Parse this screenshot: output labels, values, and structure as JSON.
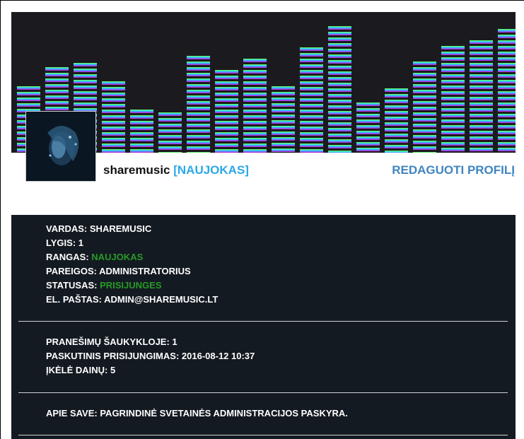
{
  "profile": {
    "username": "sharemusic",
    "rank_badge": "[NAUJOKAS]",
    "edit_label": "REDAGUOTI PROFILĮ"
  },
  "details": {
    "name_label": "VARDAS:",
    "name_value": "SHAREMUSIC",
    "level_label": "LYGIS:",
    "level_value": "1",
    "rank_label": "RANGAS:",
    "rank_value": "NAUJOKAS",
    "duties_label": "PAREIGOS:",
    "duties_value": "ADMINISTRATORIUS",
    "status_label": "STATUSAS:",
    "status_value": "PRISIJUNGES",
    "email_label": "EL. PAŠTAS:",
    "email_value": "ADMIN@SHAREMUSIC.LT"
  },
  "activity": {
    "shoutbox_label": "PRANEŠIMŲ ŠAUKYKLOJE:",
    "shoutbox_value": "1",
    "last_login_label": "PASKUTINIS PRISIJUNGIMAS:",
    "last_login_value": "2016-08-12 10:37",
    "songs_label": "ĮKĖLĖ DAINŲ:",
    "songs_value": "5"
  },
  "about": {
    "label": "APIE SAVE:",
    "value": "PAGRINDINĖ SVETAINĖS ADMINISTRACIJOS PASKYRA."
  },
  "colors": {
    "accent_blue": "#2aa8e8",
    "edit_blue": "#3f85c0",
    "panel_bg": "#141a22",
    "status_green": "#279a27"
  }
}
